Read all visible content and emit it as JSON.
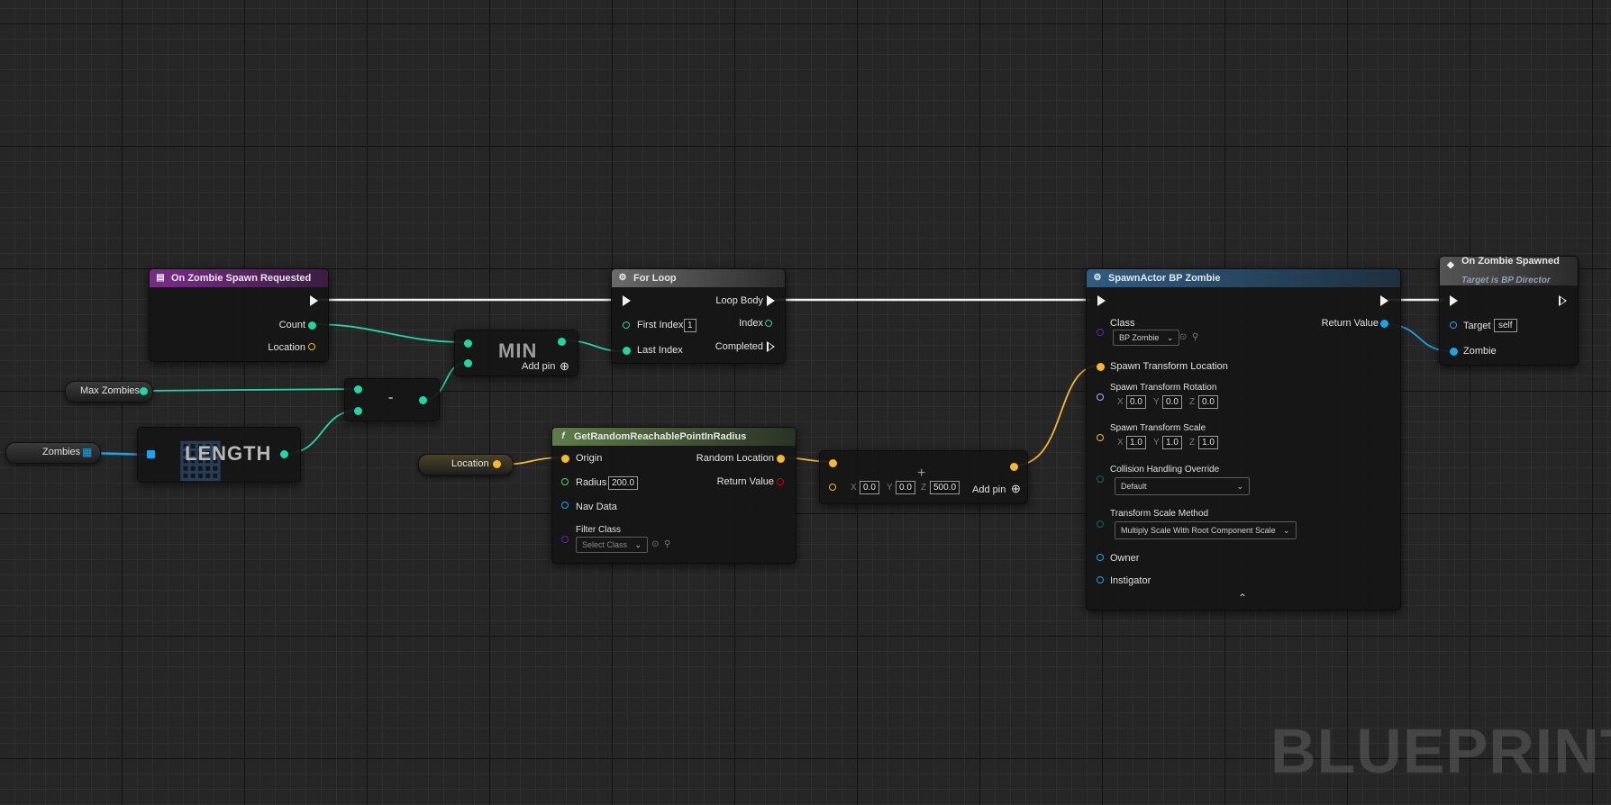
{
  "editor": {
    "watermark": "BLUEPRINT"
  },
  "colors": {
    "exec": "#f0f0f0",
    "int": "#1fd6a5",
    "vector": "#f6b928",
    "object": "#1aa5e8",
    "class": "#6a1fb2",
    "rotator": "#a0b4ff",
    "bool": "#d00000",
    "float": "#3fe23f"
  },
  "variables": {
    "max_zombies": "Max Zombies",
    "zombies": "Zombies",
    "location": "Location"
  },
  "nodes": {
    "event": {
      "title": "On Zombie Spawn Requested",
      "pins": {
        "count": "Count",
        "location": "Location"
      }
    },
    "min": {
      "title": "MIN",
      "add_pin": "Add pin"
    },
    "subtract": {
      "title": "-"
    },
    "length": {
      "title": "LENGTH"
    },
    "for_loop": {
      "title": "For Loop",
      "first_index": "First Index",
      "first_index_value": "1",
      "last_index": "Last Index",
      "loop_body": "Loop Body",
      "index": "Index",
      "completed": "Completed"
    },
    "get_random": {
      "title": "GetRandomReachablePointInRadius",
      "origin": "Origin",
      "radius": "Radius",
      "radius_value": "200.0",
      "nav_data": "Nav Data",
      "filter_class": "Filter Class",
      "filter_class_value": "Select Class",
      "random_location": "Random Location",
      "return_value": "Return Value"
    },
    "add_vector": {
      "x": "0.0",
      "y": "0.0",
      "z": "500.0",
      "add_pin": "Add pin"
    },
    "spawn_actor": {
      "title": "SpawnActor BP Zombie",
      "class": "Class",
      "class_value": "BP Zombie",
      "return_value": "Return Value",
      "spawn_location": "Spawn Transform Location",
      "spawn_rotation": "Spawn Transform Rotation",
      "rot": {
        "x": "0.0",
        "y": "0.0",
        "z": "0.0"
      },
      "spawn_scale": "Spawn Transform Scale",
      "scale": {
        "x": "1.0",
        "y": "1.0",
        "z": "1.0"
      },
      "collision": "Collision Handling Override",
      "collision_value": "Default",
      "scale_method": "Transform Scale Method",
      "scale_method_value": "Multiply Scale With Root Component Scale",
      "owner": "Owner",
      "instigator": "Instigator"
    },
    "on_spawned": {
      "title": "On Zombie Spawned",
      "subtitle": "Target is BP Director",
      "target": "Target",
      "target_value": "self",
      "zombie": "Zombie"
    }
  },
  "axis_labels": {
    "x": "X",
    "y": "Y",
    "z": "Z"
  }
}
